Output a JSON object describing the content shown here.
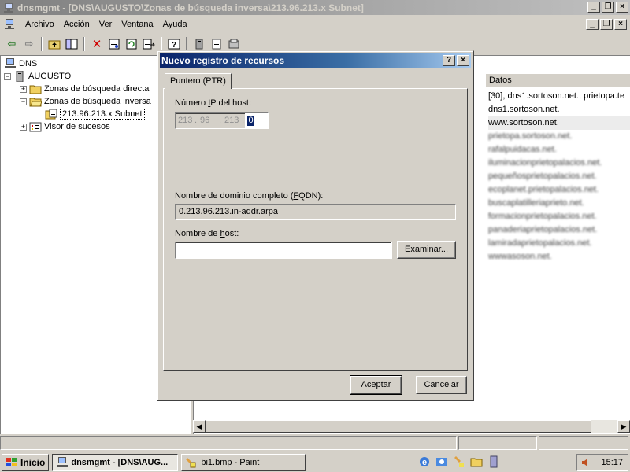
{
  "window": {
    "title": "dnsmgmt - [DNS\\AUGUSTO\\Zonas de búsqueda inversa\\213.96.213.x Subnet]"
  },
  "menu": {
    "items": [
      "Archivo",
      "Acción",
      "Ver",
      "Ventana",
      "Ayuda"
    ]
  },
  "tree": {
    "root": "DNS",
    "server": "AUGUSTO",
    "forward_zones": "Zonas de búsqueda directa",
    "reverse_zones": "Zonas de búsqueda inversa",
    "subnet": "213.96.213.x Subnet",
    "event_viewer": "Visor de sucesos"
  },
  "list": {
    "column_datos": "Datos",
    "rows": [
      "[30], dns1.sortoson.net., prietopa.te",
      "dns1.sortoson.net.",
      "www.sortoson.net.",
      "prietopa.sortoson.net.",
      "rafalpuidacas.net.",
      "iluminacionprietopalacios.net.",
      "pequeñosprietopalacios.net.",
      "ecoplanet.prietopalacios.net.",
      "buscaplatilleriaprieto.net.",
      "formacionprietopalacios.net.",
      "panaderiaprietopalacios.net.",
      "lamiradaprietopalacios.net.",
      "wwwasoson.net."
    ]
  },
  "dialog": {
    "title": "Nuevo registro de recursos",
    "help_btn": "?",
    "close_btn": "×",
    "tab_label": "Puntero (PTR)",
    "ip_label": "Número IP del host:",
    "ip": {
      "o1": "213",
      "o2": "96",
      "o3": "213",
      "o4": "0"
    },
    "fqdn_label": "Nombre de dominio completo (FQDN):",
    "fqdn_value": "0.213.96.213.in-addr.arpa",
    "host_label": "Nombre de host:",
    "host_value": "",
    "browse_btn": "Examinar...",
    "ok_btn": "Aceptar",
    "cancel_btn": "Cancelar"
  },
  "taskbar": {
    "start": "Inicio",
    "task1": "dnsmgmt - [DNS\\AUG...",
    "task2": "bi1.bmp - Paint",
    "clock": "15:17"
  }
}
